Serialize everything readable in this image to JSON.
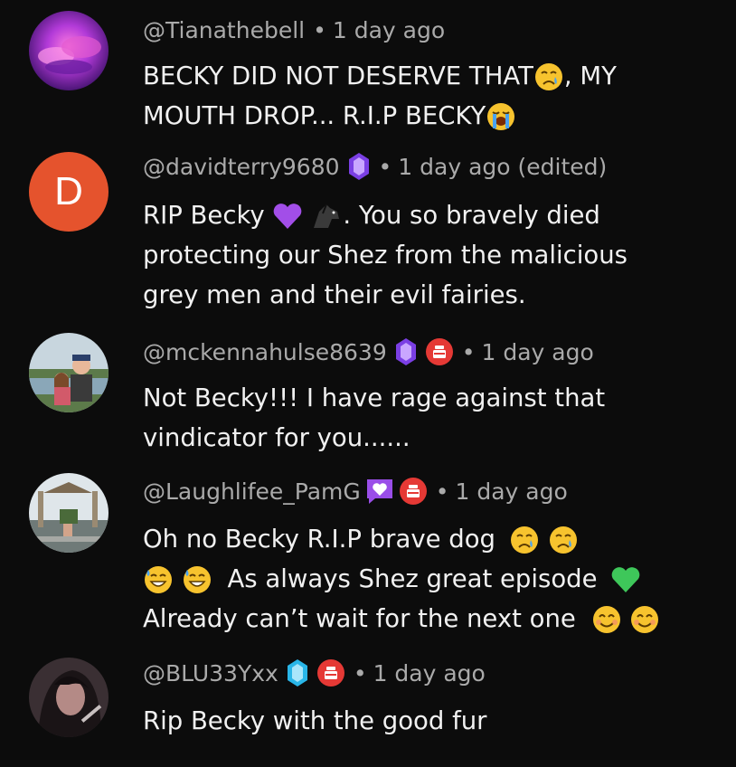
{
  "comments": [
    {
      "handle": "@Tianathebell",
      "time": "1 day ago",
      "lines": [
        "BECKY DID NOT DESERVE THAT",
        ", MY",
        "MOUTH DROP... R.I.P BECKY"
      ],
      "avatar_icon": "purple-cloud-avatar"
    },
    {
      "handle": "@davidterry9680",
      "time": "1 day ago (edited)",
      "avatar_letter": "D",
      "avatar_color": "#e5532d",
      "badges": [
        "member-gem-icon"
      ],
      "lines": [
        "RIP Becky ",
        ". You so bravely died",
        "protecting our Shez from the malicious",
        "grey men and their evil fairies."
      ]
    },
    {
      "handle": "@mckennahulse8639",
      "time": "1 day ago",
      "badges": [
        "member-gem-icon",
        "supporter-red-icon"
      ],
      "lines": [
        "Not Becky!!! I have rage against that",
        "vindicator for you......"
      ],
      "avatar_icon": "photo-couple-avatar"
    },
    {
      "handle": "@Laughlifee_PamG",
      "time": "1 day ago",
      "badges": [
        "heart-chat-icon",
        "supporter-red-icon"
      ],
      "lines": [
        "Oh no Becky R.I.P brave dog",
        "As always Shez great episode",
        "Already can’t wait for the next one"
      ],
      "avatar_icon": "photo-park-avatar"
    },
    {
      "handle": "@BLU33Yxx",
      "time": "1 day ago",
      "badges": [
        "member-gem-blue-icon",
        "supporter-red-icon"
      ],
      "lines": [
        "Rip Becky with the good fur"
      ],
      "avatar_icon": "photo-portrait-avatar"
    }
  ],
  "separator": "•",
  "colors": {
    "background": "#0c0c0c",
    "meta_text": "#aaaaaa",
    "body_text": "#f1f1f1",
    "gem_purple": "#7b3fe4",
    "gem_blue": "#29b6e8",
    "supporter_red": "#e53935"
  }
}
